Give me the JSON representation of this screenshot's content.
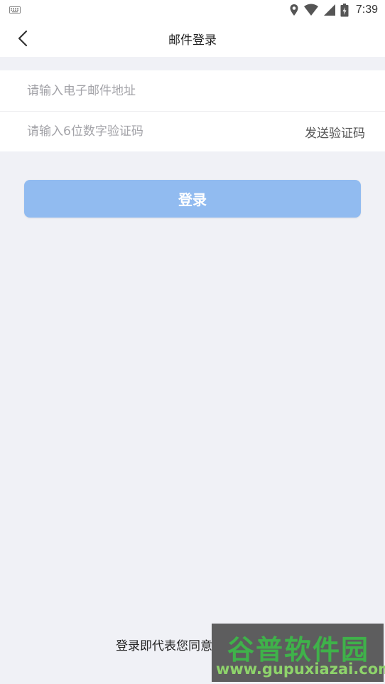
{
  "status_bar": {
    "time": "7:39",
    "icons": [
      "keyboard-icon",
      "location-icon",
      "wifi-icon",
      "signal-icon",
      "battery-icon"
    ]
  },
  "nav": {
    "title": "邮件登录",
    "back_icon": "chevron-left-icon"
  },
  "form": {
    "email_placeholder": "请输入电子邮件地址",
    "email_value": "",
    "code_placeholder": "请输入6位数字验证码",
    "code_value": "",
    "send_code_label": "发送验证码"
  },
  "login_button": {
    "label": "登录",
    "color": "#91bbf0"
  },
  "agreement": {
    "text": "登录即代表您同意"
  },
  "watermark": {
    "title": "谷普软件园",
    "url": "www.gupuxiazai.com"
  },
  "colors": {
    "background": "#f0f1f6",
    "surface": "#ffffff",
    "placeholder": "#a3a3a8",
    "watermark_green": "#3fb24a"
  }
}
